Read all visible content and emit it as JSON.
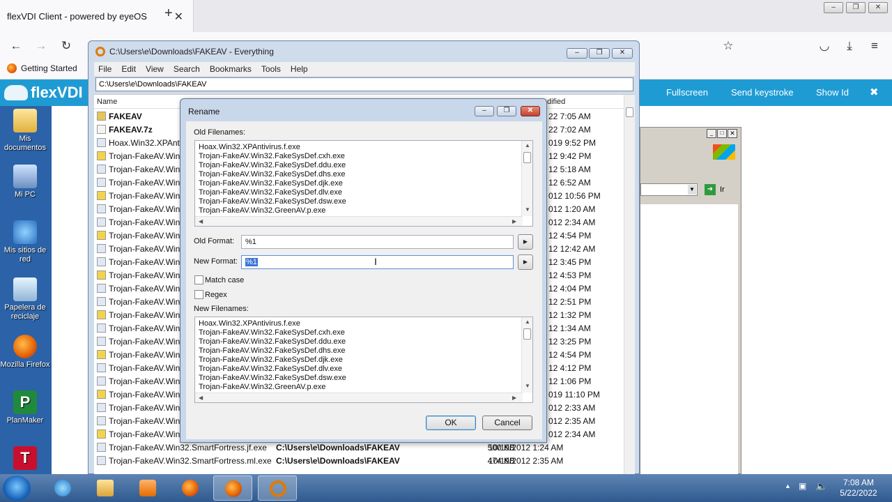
{
  "browser": {
    "tab_title": "flexVDI Client - powered by eyeOS",
    "bookmark": "Getting Started"
  },
  "vdi_toolbar": {
    "logo": "flexVDI",
    "fullscreen": "Fullscreen",
    "send_keystroke": "Send keystroke",
    "show_id": "Show Id",
    "close": "✖"
  },
  "desktop_icons": [
    {
      "label": "Mis documentos"
    },
    {
      "label": "Mi PC"
    },
    {
      "label": "Mis sitios de red"
    },
    {
      "label": "Papelera de reciclaje"
    },
    {
      "label": "Mozilla Firefox"
    },
    {
      "label": "PlanMaker"
    }
  ],
  "everything": {
    "title": "C:\\Users\\e\\Downloads\\FAKEAV - Everything",
    "menu": [
      "File",
      "Edit",
      "View",
      "Search",
      "Bookmarks",
      "Tools",
      "Help"
    ],
    "path": "C:\\Users\\e\\Downloads\\FAKEAV",
    "columns": {
      "name": "Name",
      "modified": "dified"
    },
    "rows": [
      {
        "name": "FAKEAV",
        "date": "22 7:05 AM",
        "bold": true
      },
      {
        "name": "FAKEAV.7z",
        "date": "22 7:02 AM",
        "bold": true
      },
      {
        "name": "Hoax.Win32.XPAnti",
        "date": "019 9:52 PM"
      },
      {
        "name": "Trojan-FakeAV.Win",
        "date": "12 9:42 PM"
      },
      {
        "name": "Trojan-FakeAV.Win",
        "date": "12 5:18 AM"
      },
      {
        "name": "Trojan-FakeAV.Win",
        "date": "12 6:52 AM"
      },
      {
        "name": "Trojan-FakeAV.Win",
        "date": "012 10:56 PM"
      },
      {
        "name": "Trojan-FakeAV.Win",
        "date": "012 1:20 AM"
      },
      {
        "name": "Trojan-FakeAV.Win",
        "date": "012 2:34 AM"
      },
      {
        "name": "Trojan-FakeAV.Win",
        "date": "12 4:54 PM"
      },
      {
        "name": "Trojan-FakeAV.Win",
        "date": "12 12:42 AM"
      },
      {
        "name": "Trojan-FakeAV.Win",
        "date": "12 3:45 PM"
      },
      {
        "name": "Trojan-FakeAV.Win",
        "date": "12 4:53 PM"
      },
      {
        "name": "Trojan-FakeAV.Win",
        "date": "12 4:04 PM"
      },
      {
        "name": "Trojan-FakeAV.Win",
        "date": "12 2:51 PM"
      },
      {
        "name": "Trojan-FakeAV.Win",
        "date": "12 1:32 PM"
      },
      {
        "name": "Trojan-FakeAV.Win",
        "date": "12 1:34 AM"
      },
      {
        "name": "Trojan-FakeAV.Win",
        "date": "12 3:25 PM"
      },
      {
        "name": "Trojan-FakeAV.Win",
        "date": "12 4:54 PM"
      },
      {
        "name": "Trojan-FakeAV.Win",
        "date": "12 4:12 PM"
      },
      {
        "name": "Trojan-FakeAV.Win",
        "date": "12 1:06 PM"
      },
      {
        "name": "Trojan-FakeAV.Win",
        "date": "019 11:10 PM"
      },
      {
        "name": "Trojan-FakeAV.Win",
        "date": "012 2:33 AM"
      },
      {
        "name": "Trojan-FakeAV.Win",
        "date": "012 2:35 AM"
      },
      {
        "name": "Trojan-FakeAV.Win",
        "date": "012 2:34 AM"
      },
      {
        "name": "Trojan-FakeAV.Win32.SmartFortress.jf.exe",
        "path": "C:\\Users\\e\\Downloads\\FAKEAV",
        "size": "500 KB",
        "date": "10/19/2012 1:24 AM"
      },
      {
        "name": "Trojan-FakeAV.Win32.SmartFortress.ml.exe",
        "path": "C:\\Users\\e\\Downloads\\FAKEAV",
        "size": "474 KB",
        "date": "10/19/2012 2:35 AM"
      }
    ]
  },
  "rename_dialog": {
    "title": "Rename",
    "old_filenames_label": "Old Filenames:",
    "old_filenames": [
      "Hoax.Win32.XPAntivirus.f.exe",
      "Trojan-FakeAV.Win32.FakeSysDef.cxh.exe",
      "Trojan-FakeAV.Win32.FakeSysDef.ddu.exe",
      "Trojan-FakeAV.Win32.FakeSysDef.dhs.exe",
      "Trojan-FakeAV.Win32.FakeSysDef.djk.exe",
      "Trojan-FakeAV.Win32.FakeSysDef.dlv.exe",
      "Trojan-FakeAV.Win32.FakeSysDef.dsw.exe",
      "Trojan-FakeAV.Win32.GreenAV.p.exe"
    ],
    "old_format_label": "Old Format:",
    "old_format_value": "%1",
    "new_format_label": "New Format:",
    "new_format_value": "%1",
    "match_case_label": "Match case",
    "regex_label": "Regex",
    "new_filenames_label": "New Filenames:",
    "new_filenames": [
      "Hoax.Win32.XPAntivirus.f.exe",
      "Trojan-FakeAV.Win32.FakeSysDef.cxh.exe",
      "Trojan-FakeAV.Win32.FakeSysDef.ddu.exe",
      "Trojan-FakeAV.Win32.FakeSysDef.dhs.exe",
      "Trojan-FakeAV.Win32.FakeSysDef.djk.exe",
      "Trojan-FakeAV.Win32.FakeSysDef.dlv.exe",
      "Trojan-FakeAV.Win32.FakeSysDef.dsw.exe",
      "Trojan-FakeAV.Win32.GreenAV.p.exe"
    ],
    "ok_label": "OK",
    "cancel_label": "Cancel"
  },
  "background_window": {
    "go_label": "Ir"
  },
  "taskbar": {
    "time": "7:08 AM",
    "date": "5/22/2022"
  },
  "colors": {
    "vdi_blue": "#1f9bd4",
    "selection": "#3875d7",
    "taskbar": "#2f5a8f"
  }
}
